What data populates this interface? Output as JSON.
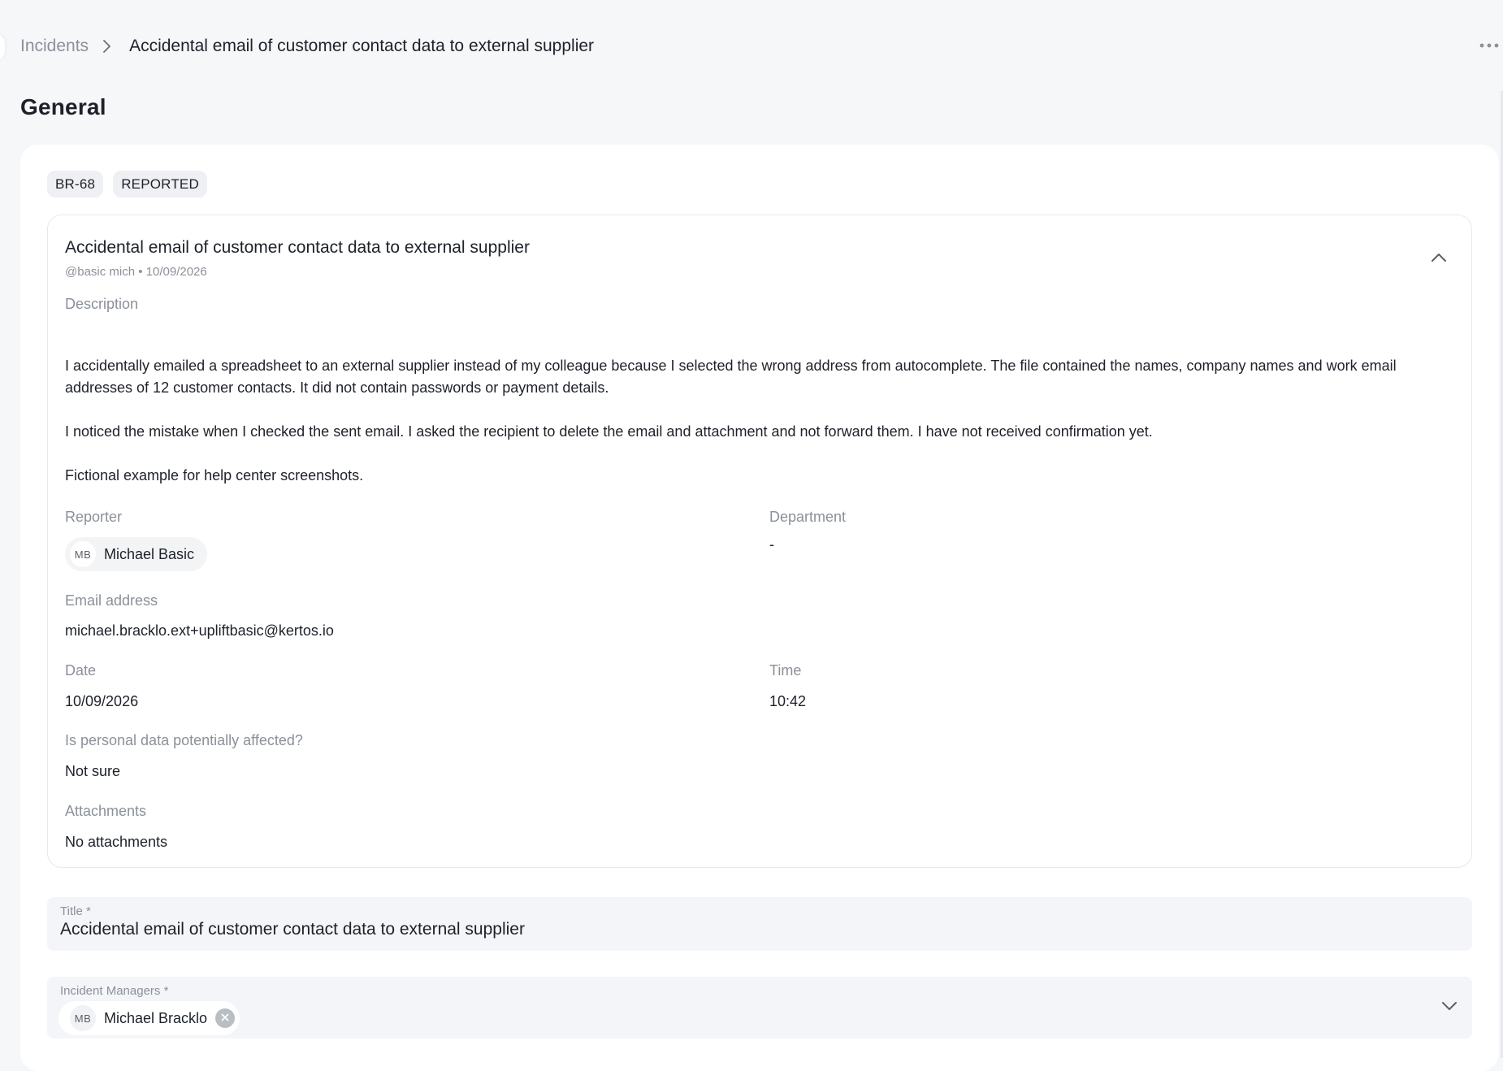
{
  "breadcrumb": {
    "parent": "Incidents",
    "current": "Accidental email of customer contact data to external supplier"
  },
  "page": {
    "title": "General"
  },
  "tags": {
    "id": "BR-68",
    "status": "REPORTED"
  },
  "report": {
    "title": "Accidental email of customer contact data to external supplier",
    "meta": "@basic mich • 10/09/2026",
    "description_label": "Description",
    "description": [
      "I accidentally emailed a spreadsheet to an external supplier instead of my colleague because I selected the wrong address from autocomplete. The file contained the names, company names and work email addresses of 12 customer contacts. It did not contain passwords or payment details.",
      "I noticed the mistake when I checked the sent email. I asked the recipient to delete the email and attachment and not forward them. I have not received confirmation yet.",
      "Fictional example for help center screenshots."
    ],
    "reporter_label": "Reporter",
    "reporter": {
      "initials": "MB",
      "name": "Michael Basic"
    },
    "department_label": "Department",
    "department": "-",
    "email_label": "Email address",
    "email": "michael.bracklo.ext+upliftbasic@kertos.io",
    "date_label": "Date",
    "date": "10/09/2026",
    "time_label": "Time",
    "time": "10:42",
    "personal_data_label": "Is personal data potentially affected?",
    "personal_data": "Not sure",
    "attachments_label": "Attachments",
    "attachments": "No attachments"
  },
  "form": {
    "title_label": "Title *",
    "title_value": "Accidental email of customer contact data to external supplier",
    "managers_label": "Incident Managers *",
    "managers": [
      {
        "initials": "MB",
        "name": "Michael Bracklo"
      }
    ]
  },
  "icons": {
    "breadcrumb_separator": "chevron-right-icon",
    "more": "more-horizontal-icon",
    "collapse": "chevron-up-icon",
    "remove": "close-circle-icon",
    "dropdown": "chevron-down-icon"
  }
}
